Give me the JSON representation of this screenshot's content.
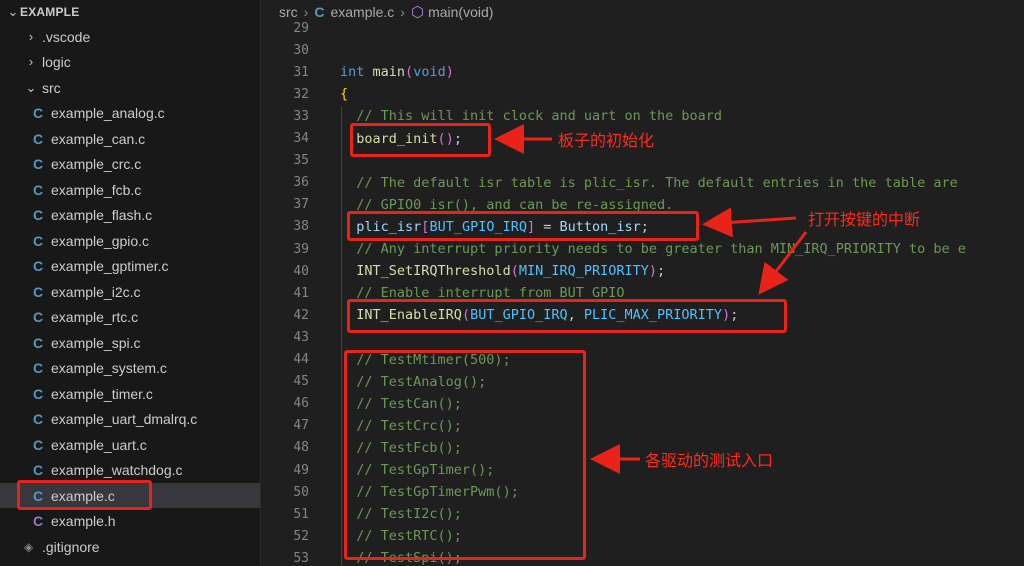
{
  "explorer": {
    "title": "EXAMPLE",
    "items": [
      {
        "label": ".vscode",
        "type": "folder",
        "expanded": false
      },
      {
        "label": "logic",
        "type": "folder",
        "expanded": false
      },
      {
        "label": "src",
        "type": "folder",
        "expanded": true
      },
      {
        "label": "example_analog.c",
        "type": "c"
      },
      {
        "label": "example_can.c",
        "type": "c"
      },
      {
        "label": "example_crc.c",
        "type": "c"
      },
      {
        "label": "example_fcb.c",
        "type": "c"
      },
      {
        "label": "example_flash.c",
        "type": "c"
      },
      {
        "label": "example_gpio.c",
        "type": "c"
      },
      {
        "label": "example_gptimer.c",
        "type": "c"
      },
      {
        "label": "example_i2c.c",
        "type": "c"
      },
      {
        "label": "example_rtc.c",
        "type": "c"
      },
      {
        "label": "example_spi.c",
        "type": "c"
      },
      {
        "label": "example_system.c",
        "type": "c"
      },
      {
        "label": "example_timer.c",
        "type": "c"
      },
      {
        "label": "example_uart_dmalrq.c",
        "type": "c"
      },
      {
        "label": "example_uart.c",
        "type": "c"
      },
      {
        "label": "example_watchdog.c",
        "type": "c"
      },
      {
        "label": "example.c",
        "type": "c",
        "selected": true
      },
      {
        "label": "example.h",
        "type": "h"
      },
      {
        "label": ".gitignore",
        "type": "git"
      }
    ],
    "c_icon": "C",
    "h_icon": "C"
  },
  "breadcrumb": {
    "parts": [
      "src",
      "example.c",
      "main(void)"
    ],
    "file_icon": "C",
    "method_icon": "cube-icon"
  },
  "code": {
    "line_numbers": [
      "29",
      "30",
      "31",
      "32",
      "33",
      "34",
      "35",
      "36",
      "37",
      "38",
      "39",
      "40",
      "41",
      "42",
      "43",
      "44",
      "45",
      "46",
      "47",
      "48",
      "49",
      "50",
      "51",
      "52",
      "53"
    ],
    "lines": [
      "",
      "",
      "int main(void)",
      "{",
      "  // This will init clock and uart on the board",
      "  board_init();",
      "",
      "  // The default isr table is plic_isr. The default entries in the table are",
      "  // GPIO0 isr(), and can be re-assigned.",
      "  plic_isr[BUT_GPIO_IRQ] = Button_isr;",
      "  // Any interrupt priority needs to be greater than MIN_IRQ_PRIORITY to be e",
      "  INT_SetIRQThreshold(MIN_IRQ_PRIORITY);",
      "  // Enable interrupt from BUT_GPIO",
      "  INT_EnableIRQ(BUT_GPIO_IRQ, PLIC_MAX_PRIORITY);",
      "",
      "  // TestMtimer(500);",
      "  // TestAnalog();",
      "  // TestCan();",
      "  // TestCrc();",
      "  // TestFcb();",
      "  // TestGpTimer();",
      "  // TestGpTimerPwm();",
      "  // TestI2c();",
      "  // TestRTC();",
      "  // TestSpi();"
    ]
  },
  "annotations": {
    "board_init": "板子的初始化",
    "enable_irq": "打开按键的中断",
    "tests": "各驱动的测试入口"
  },
  "colors": {
    "highlight": "#e8231a",
    "keyword": "#569cd6",
    "function": "#dcdcaa",
    "comment": "#6a9955",
    "macro": "#4fc1ff"
  }
}
